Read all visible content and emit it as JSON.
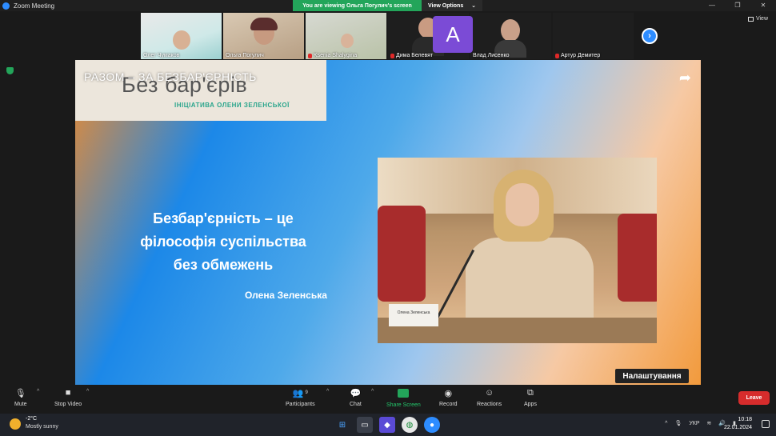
{
  "window": {
    "title": "Zoom Meeting"
  },
  "banner": {
    "viewing": "You are viewing Ольга Погулич's screen",
    "view_options": "View Options"
  },
  "view_label": "View",
  "participants": [
    {
      "name": "Олег Чумаков",
      "muted": false
    },
    {
      "name": "Ольга Погулич",
      "muted": false
    },
    {
      "name": "Ksenia Shalygina",
      "muted": true
    },
    {
      "name": "Дима Белевят",
      "muted": true
    },
    {
      "name": "Влад Лисенко",
      "muted": false
    },
    {
      "name": "Артур Демитер",
      "muted": true
    }
  ],
  "avatar_letter": "A",
  "share": {
    "title": "РАЗОМ – ЗА БЕЗБАР'ЄРНІСТЬ",
    "logo_main": "Без бар'єрів",
    "logo_sub": "ІНІЦІАТИВА ОЛЕНИ ЗЕЛЕНСЬКОЇ",
    "quote": [
      "Безбар'єрність – це",
      "філософія суспільства",
      "без обмежень"
    ],
    "author": "Олена Зеленська",
    "nameplate": "Олена Зеленська",
    "settings_tag": "Налаштування"
  },
  "toolbar": {
    "mute": "Mute",
    "stop_video": "Stop Video",
    "participants": "Participants",
    "participants_count": "9",
    "chat": "Chat",
    "share_screen": "Share Screen",
    "record": "Record",
    "reactions": "Reactions",
    "apps": "Apps",
    "leave": "Leave"
  },
  "taskbar": {
    "temp": "-2°C",
    "condition": "Mostly sunny",
    "lang": "УКР",
    "time": "10:18",
    "date": "22.01.2024"
  },
  "colors": {
    "accent_green": "#23a55a",
    "leave_red": "#d62c2c",
    "zoom_blue": "#2d8cff"
  }
}
